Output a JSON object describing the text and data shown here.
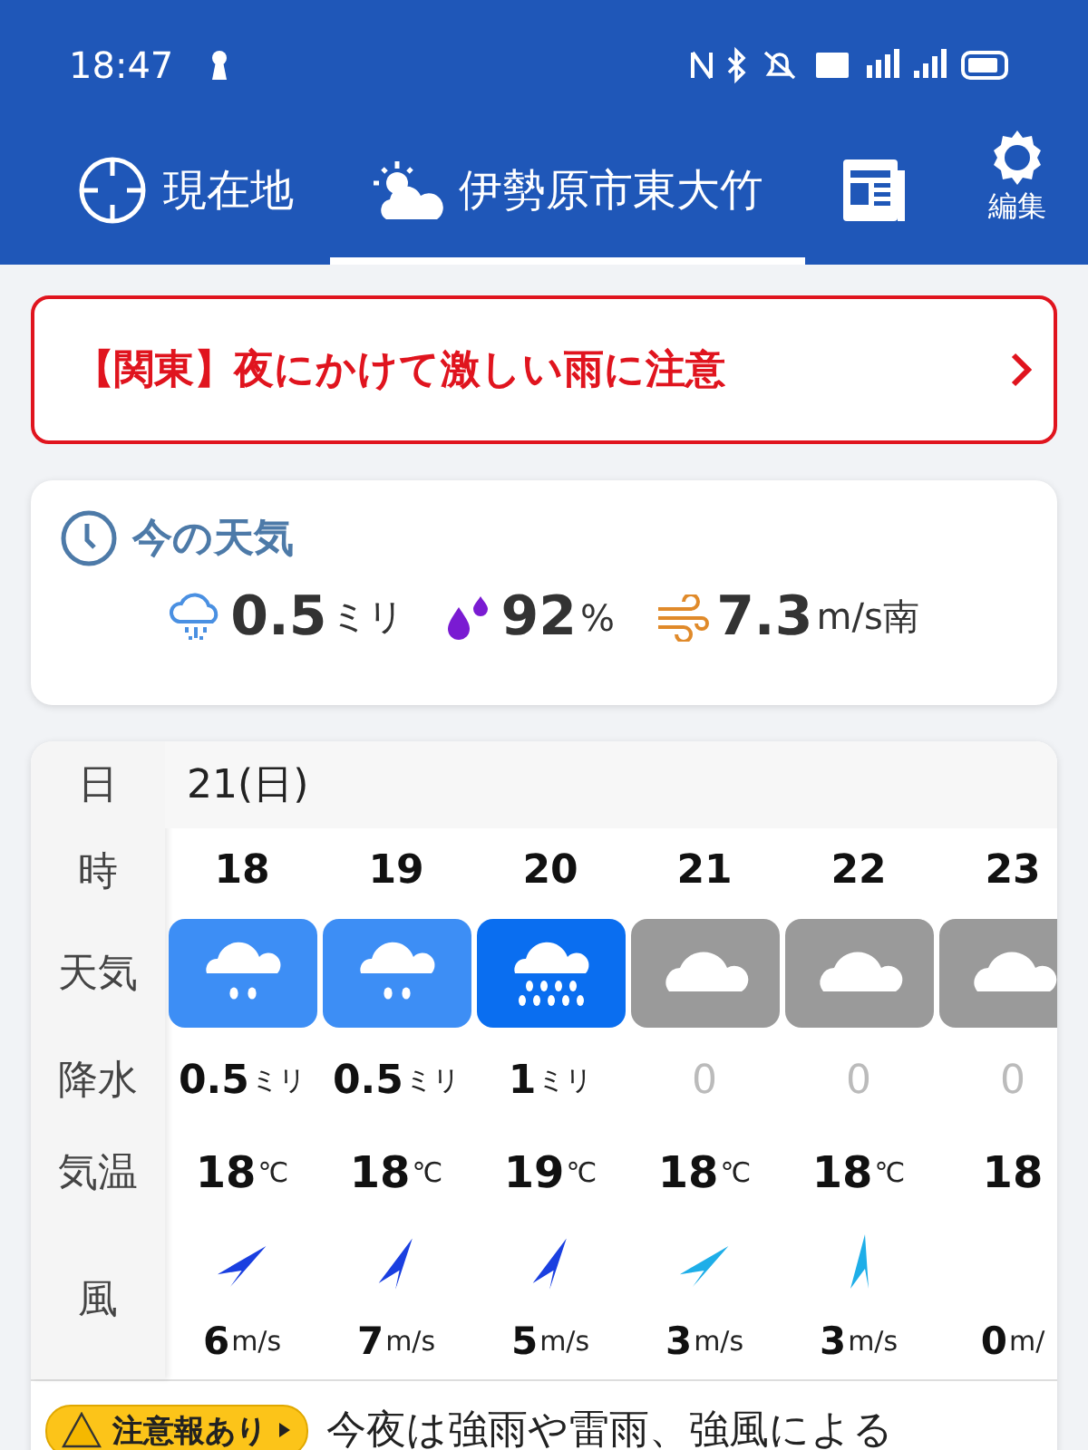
{
  "status_bar": {
    "time": "18:47"
  },
  "tabs": [
    {
      "kind": "location",
      "label": "現在地",
      "selected": false
    },
    {
      "kind": "weather",
      "label": "伊勢原市東大竹",
      "selected": true
    },
    {
      "kind": "news",
      "selected": false
    }
  ],
  "settings_button": {
    "label": "編集"
  },
  "alert_banner": {
    "text": "【関東】夜にかけて激しい雨に注意"
  },
  "current_weather": {
    "title": "今の天気",
    "precipitation": {
      "value": "0.5",
      "unit": "ミリ"
    },
    "humidity": {
      "value": "92",
      "unit": "%"
    },
    "wind": {
      "value": "7.3",
      "unit": "m/s南"
    }
  },
  "forecast": {
    "row_labels": [
      "日",
      "時",
      "天気",
      "降水",
      "気温",
      "風"
    ],
    "date": "21(日)",
    "hours": [
      {
        "hour": "18",
        "kind": "rain",
        "precip": "0.5",
        "precip_unit": "ミリ",
        "precip_muted": false,
        "temp": "18",
        "temp_unit": "℃",
        "wind_arrow": {
          "kind": "northeast",
          "color": "#1a3fe0"
        },
        "wind": "6",
        "wind_unit": "m/s"
      },
      {
        "hour": "19",
        "kind": "rain",
        "precip": "0.5",
        "precip_unit": "ミリ",
        "precip_muted": false,
        "temp": "18",
        "temp_unit": "℃",
        "wind_arrow": {
          "kind": "north-northeast",
          "color": "#1a3fe0"
        },
        "wind": "7",
        "wind_unit": "m/s"
      },
      {
        "hour": "20",
        "kind": "heavy-rain",
        "precip": "1",
        "precip_unit": "ミリ",
        "precip_muted": false,
        "temp": "19",
        "temp_unit": "℃",
        "wind_arrow": {
          "kind": "north-northeast",
          "color": "#1a3fe0"
        },
        "wind": "5",
        "wind_unit": "m/s"
      },
      {
        "hour": "21",
        "kind": "cloudy",
        "precip": "0",
        "precip_muted": true,
        "temp": "18",
        "temp_unit": "℃",
        "wind_arrow": {
          "kind": "northeast",
          "color": "#1eaee8"
        },
        "wind": "3",
        "wind_unit": "m/s"
      },
      {
        "hour": "22",
        "kind": "cloudy",
        "precip": "0",
        "precip_muted": true,
        "temp": "18",
        "temp_unit": "℃",
        "wind_arrow": {
          "kind": "north",
          "color": "#1eaee8"
        },
        "wind": "3",
        "wind_unit": "m/s"
      },
      {
        "hour": "23",
        "kind": "cloudy",
        "precip": "0",
        "precip_muted": true,
        "temp": "18",
        "wind": "0",
        "wind_unit": "m/"
      }
    ]
  },
  "advisory": {
    "badge": "注意報あり",
    "text": "今夜は強雨や雷雨、強風による"
  }
}
